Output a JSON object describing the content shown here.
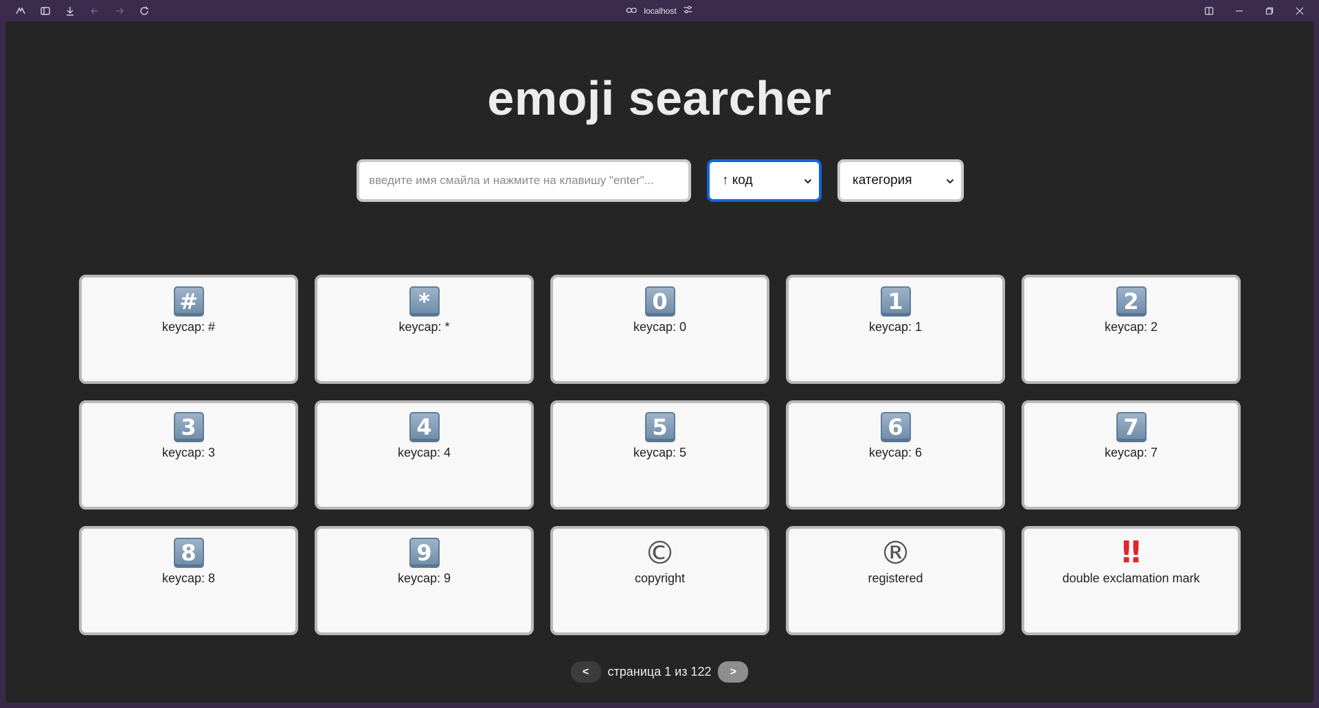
{
  "browser": {
    "address": "localhost",
    "icons": [
      "workspaces-icon",
      "sidebar-icon",
      "download-icon",
      "back-icon",
      "forward-icon",
      "reload-icon"
    ]
  },
  "page": {
    "title": "emoji searcher",
    "search": {
      "placeholder": "введите имя смайла и нажмите на клавишу \"enter\"...",
      "value": ""
    },
    "sort_select": {
      "value": "↑ код"
    },
    "category_select": {
      "value": "категория"
    }
  },
  "cards": [
    {
      "emoji": "#",
      "kind": "keycap",
      "label": "keycap: #"
    },
    {
      "emoji": "*",
      "kind": "keycap",
      "label": "keycap: *"
    },
    {
      "emoji": "0",
      "kind": "keycap",
      "label": "keycap: 0"
    },
    {
      "emoji": "1",
      "kind": "keycap",
      "label": "keycap: 1"
    },
    {
      "emoji": "2",
      "kind": "keycap",
      "label": "keycap: 2"
    },
    {
      "emoji": "3",
      "kind": "keycap",
      "label": "keycap: 3"
    },
    {
      "emoji": "4",
      "kind": "keycap",
      "label": "keycap: 4"
    },
    {
      "emoji": "5",
      "kind": "keycap",
      "label": "keycap: 5"
    },
    {
      "emoji": "6",
      "kind": "keycap",
      "label": "keycap: 6"
    },
    {
      "emoji": "7",
      "kind": "keycap",
      "label": "keycap: 7"
    },
    {
      "emoji": "8",
      "kind": "keycap",
      "label": "keycap: 8"
    },
    {
      "emoji": "9",
      "kind": "keycap",
      "label": "keycap: 9"
    },
    {
      "emoji": "©",
      "kind": "symbol",
      "label": "copyright"
    },
    {
      "emoji": "®",
      "kind": "symbol",
      "label": "registered"
    },
    {
      "emoji": "‼",
      "kind": "red",
      "label": "double exclamation mark"
    }
  ],
  "pagination": {
    "prev_label": "<",
    "next_label": ">",
    "status": "страница 1 из 122"
  }
}
